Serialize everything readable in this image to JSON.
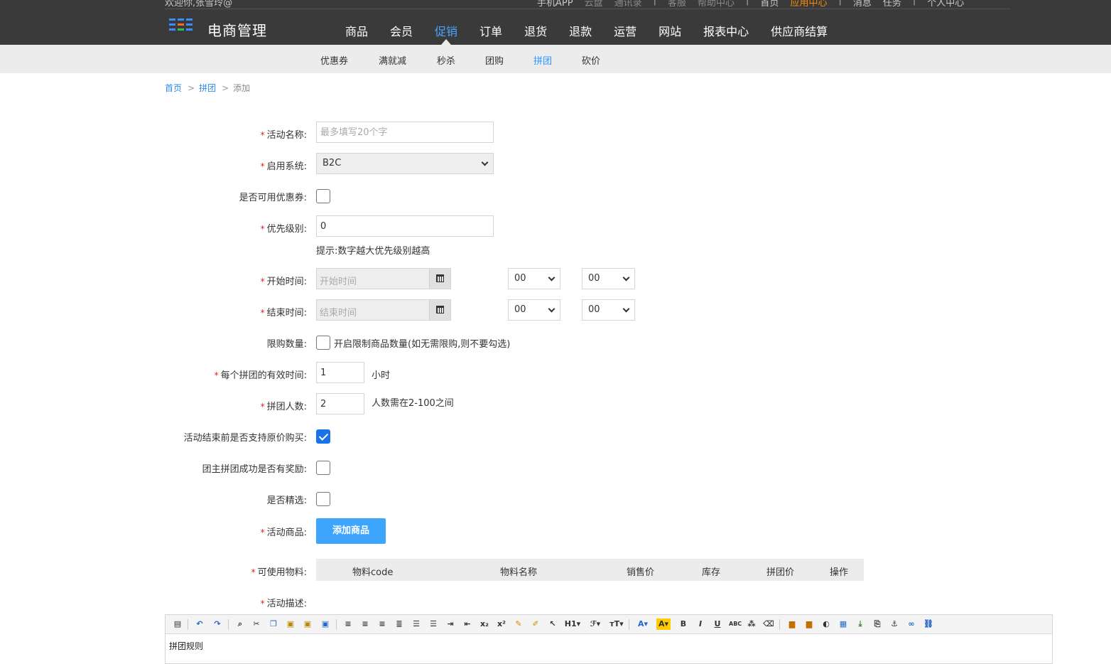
{
  "header": {
    "welcome": "欢迎你,张雪玲@",
    "top_links": [
      "手机APP",
      "云盘",
      "通讯录",
      "|",
      "客服",
      "帮助中心",
      "|",
      "首页",
      "应用中心",
      "|",
      "消息",
      "任务",
      "|",
      "个人中心"
    ],
    "brand": "电商管理",
    "nav": [
      "商品",
      "会员",
      "促销",
      "订单",
      "退货",
      "退款",
      "运营",
      "网站",
      "报表中心",
      "供应商结算"
    ],
    "active_nav": "促销"
  },
  "subnav": {
    "items": [
      "优惠券",
      "满就减",
      "秒杀",
      "团购",
      "拼团",
      "砍价"
    ],
    "active": "拼团"
  },
  "breadcrumb": {
    "home": "首页",
    "section": "拼团",
    "current": "添加",
    "sep": ">"
  },
  "form": {
    "required_mark": "*",
    "activity_name": {
      "label": "活动名称:",
      "placeholder": "最多填写20个字",
      "value": ""
    },
    "system": {
      "label": "启用系统:",
      "value": "B2C"
    },
    "coupon_usable": {
      "label": "是否可用优惠券:",
      "checked": false
    },
    "priority": {
      "label": "优先级别:",
      "value": "0",
      "hint": "提示:数字越大优先级别越高"
    },
    "start_time": {
      "label": "开始时间:",
      "placeholder": "开始时间",
      "hour": "00",
      "minute": "00"
    },
    "end_time": {
      "label": "结束时间:",
      "placeholder": "结束时间",
      "hour": "00",
      "minute": "00"
    },
    "limit_qty": {
      "label": "限购数量:",
      "checked": false,
      "text": "开启限制商品数量(如无需限购,则不要勾选)"
    },
    "valid_hours": {
      "label": "每个拼团的有效时间:",
      "value": "1",
      "unit": "小时"
    },
    "group_size": {
      "label": "拼团人数:",
      "value": "2",
      "hint": "人数需在2-100之间"
    },
    "original_price": {
      "label": "活动结束前是否支持原价购买:",
      "checked": true
    },
    "leader_reward": {
      "label": "团主拼团成功是否有奖励:",
      "checked": false
    },
    "featured": {
      "label": "是否精选:",
      "checked": false
    },
    "products": {
      "label": "活动商品:",
      "button": "添加商品"
    },
    "materials": {
      "label": "可使用物料:",
      "columns": [
        "物料code",
        "物料名称",
        "销售价",
        "库存",
        "拼团价",
        "操作"
      ]
    },
    "description": {
      "label": "活动描述:",
      "content": "拼团规则"
    }
  },
  "editor_toolbar": [
    "source-icon",
    "undo-icon",
    "redo-icon",
    "find-icon",
    "cut-icon",
    "copy-icon",
    "paste-icon",
    "paste-text-icon",
    "paste-word-icon",
    "align-left-icon",
    "align-center-icon",
    "align-right-icon",
    "justify-icon",
    "ordered-list-icon",
    "unordered-list-icon",
    "indent-icon",
    "outdent-icon",
    "subscript-icon",
    "superscript-icon",
    "clear-format-icon",
    "format-brush-icon",
    "select-icon",
    "heading-icon",
    "font-family-icon",
    "font-size-icon",
    "font-color-icon",
    "highlight-icon",
    "bold-icon",
    "italic-icon",
    "underline-icon",
    "strikethrough-icon",
    "hr-icon",
    "eraser-icon",
    "image-icon",
    "multi-image-icon",
    "flash-icon",
    "media-icon",
    "table-icon",
    "insert-icon",
    "page-break-icon",
    "anchor-icon",
    "link-icon",
    "unlink-icon"
  ],
  "colors": {
    "header_bg": "#3a3a3a",
    "accent": "#2e93ff",
    "button": "#3ea5ff",
    "highlight": "#ff8a00",
    "required": "#e02020"
  }
}
